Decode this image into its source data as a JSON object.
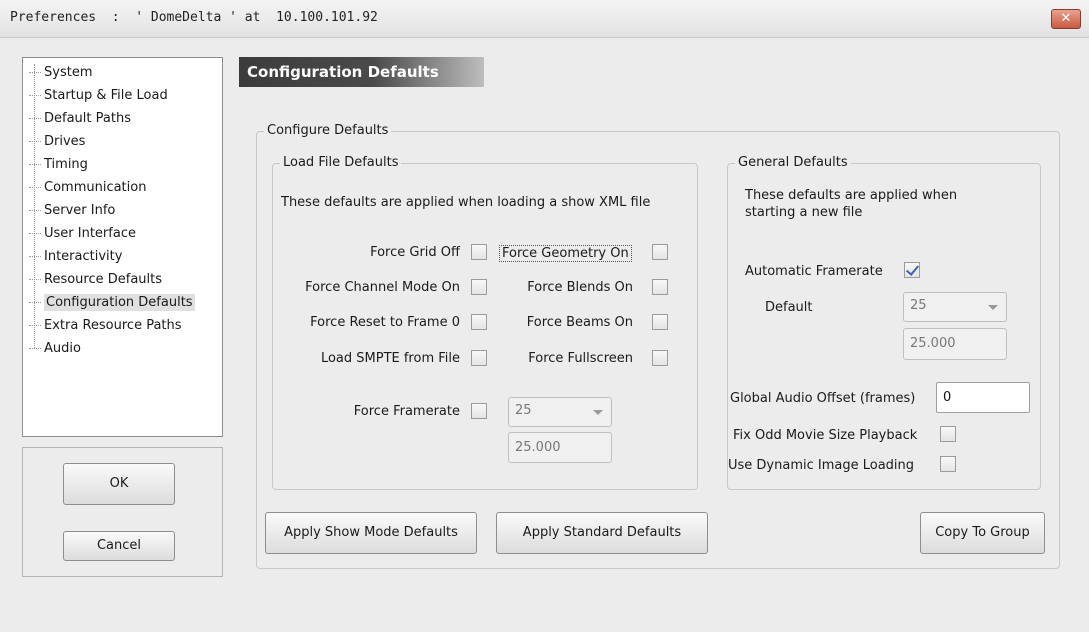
{
  "window": {
    "title": "Preferences  :  ' DomeDelta ' at  10.100.101.92",
    "close_glyph": "✕"
  },
  "sidebar": {
    "items": [
      {
        "label": "System"
      },
      {
        "label": "Startup & File Load"
      },
      {
        "label": "Default Paths"
      },
      {
        "label": "Drives"
      },
      {
        "label": "Timing"
      },
      {
        "label": "Communication"
      },
      {
        "label": "Server Info"
      },
      {
        "label": "User Interface"
      },
      {
        "label": "Interactivity"
      },
      {
        "label": "Resource Defaults"
      },
      {
        "label": "Configuration Defaults",
        "selected": true
      },
      {
        "label": "Extra Resource Paths"
      },
      {
        "label": "Audio"
      }
    ]
  },
  "dialog_buttons": {
    "ok": "OK",
    "cancel": "Cancel"
  },
  "page": {
    "header": "Configuration Defaults",
    "configure_group": "Configure Defaults",
    "load_file": {
      "title": "Load File Defaults",
      "description": "These defaults are applied when loading a show XML file",
      "force_grid_off": {
        "label": "Force Grid Off",
        "checked": false
      },
      "force_geometry_on": {
        "label": "Force Geometry On",
        "checked": false
      },
      "force_channel_mode_on": {
        "label": "Force Channel Mode On",
        "checked": false
      },
      "force_blends_on": {
        "label": "Force Blends On",
        "checked": false
      },
      "force_reset_to_frame_0": {
        "label": "Force Reset to Frame 0",
        "checked": false
      },
      "force_beams_on": {
        "label": "Force Beams On",
        "checked": false
      },
      "load_smpte_from_file": {
        "label": "Load SMPTE from File",
        "checked": false
      },
      "force_fullscreen": {
        "label": "Force Fullscreen",
        "checked": false
      },
      "force_framerate": {
        "label": "Force Framerate",
        "checked": false
      },
      "framerate_select": "25",
      "framerate_value": "25.000"
    },
    "general": {
      "title": "General Defaults",
      "description_line1": "These defaults are applied when",
      "description_line2": "starting a new file",
      "automatic_framerate": {
        "label": "Automatic Framerate",
        "checked": true
      },
      "default_label": "Default",
      "default_select": "25",
      "default_value": "25.000",
      "global_audio_offset_label": "Global Audio Offset (frames)",
      "global_audio_offset_value": "0",
      "fix_odd_movie_size": {
        "label": "Fix Odd Movie Size Playback",
        "checked": false
      },
      "dynamic_image_loading": {
        "label": "Use Dynamic Image Loading",
        "checked": false
      }
    },
    "buttons": {
      "apply_show_mode": "Apply Show Mode Defaults",
      "apply_standard": "Apply Standard Defaults",
      "copy_to_group": "Copy To Group"
    }
  },
  "colors": {
    "header_bg": "#3c3c3c",
    "close_button": "#c85a40",
    "checkmark": "#3b64b8"
  }
}
